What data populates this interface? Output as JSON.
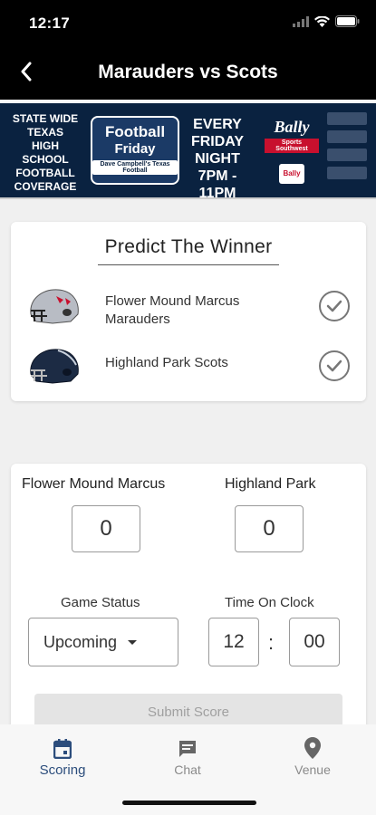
{
  "status_bar": {
    "time": "12:17"
  },
  "nav": {
    "title": "Marauders vs Scots"
  },
  "banner": {
    "left_lines": [
      "State Wide",
      "Texas",
      "High School",
      "Football",
      "Coverage"
    ],
    "logo_line1": "Football",
    "logo_line2": "Friday",
    "logo_line3": "Dave Campbell's Texas Football",
    "center_lines": [
      "Every",
      "Friday",
      "Night",
      "7PM - 11PM"
    ],
    "bally_name": "Bally",
    "bally_sub": "Sports Southwest",
    "bally_badge": "Bally"
  },
  "predict": {
    "title": "Predict The Winner",
    "teams": [
      {
        "name": "Flower Mound Marcus Marauders",
        "helmet_color": "#b8bcc4"
      },
      {
        "name": "Highland Park Scots",
        "helmet_color": "#1c2b44"
      }
    ]
  },
  "score": {
    "home_label": "Flower Mound Marcus",
    "away_label": "Highland Park",
    "home_score": "0",
    "away_score": "0",
    "game_status_label": "Game Status",
    "game_status_value": "Upcoming",
    "time_label": "Time On Clock",
    "clock_minutes": "12",
    "clock_seconds": "00",
    "clock_separator": ":",
    "submit_label": "Submit Score"
  },
  "tabs": [
    {
      "label": "Scoring",
      "icon": "calendar-icon",
      "active": true
    },
    {
      "label": "Chat",
      "icon": "chat-icon",
      "active": false
    },
    {
      "label": "Venue",
      "icon": "location-pin-icon",
      "active": false
    }
  ],
  "colors": {
    "accent": "#2c4d7c",
    "nav_bg": "#000000"
  }
}
